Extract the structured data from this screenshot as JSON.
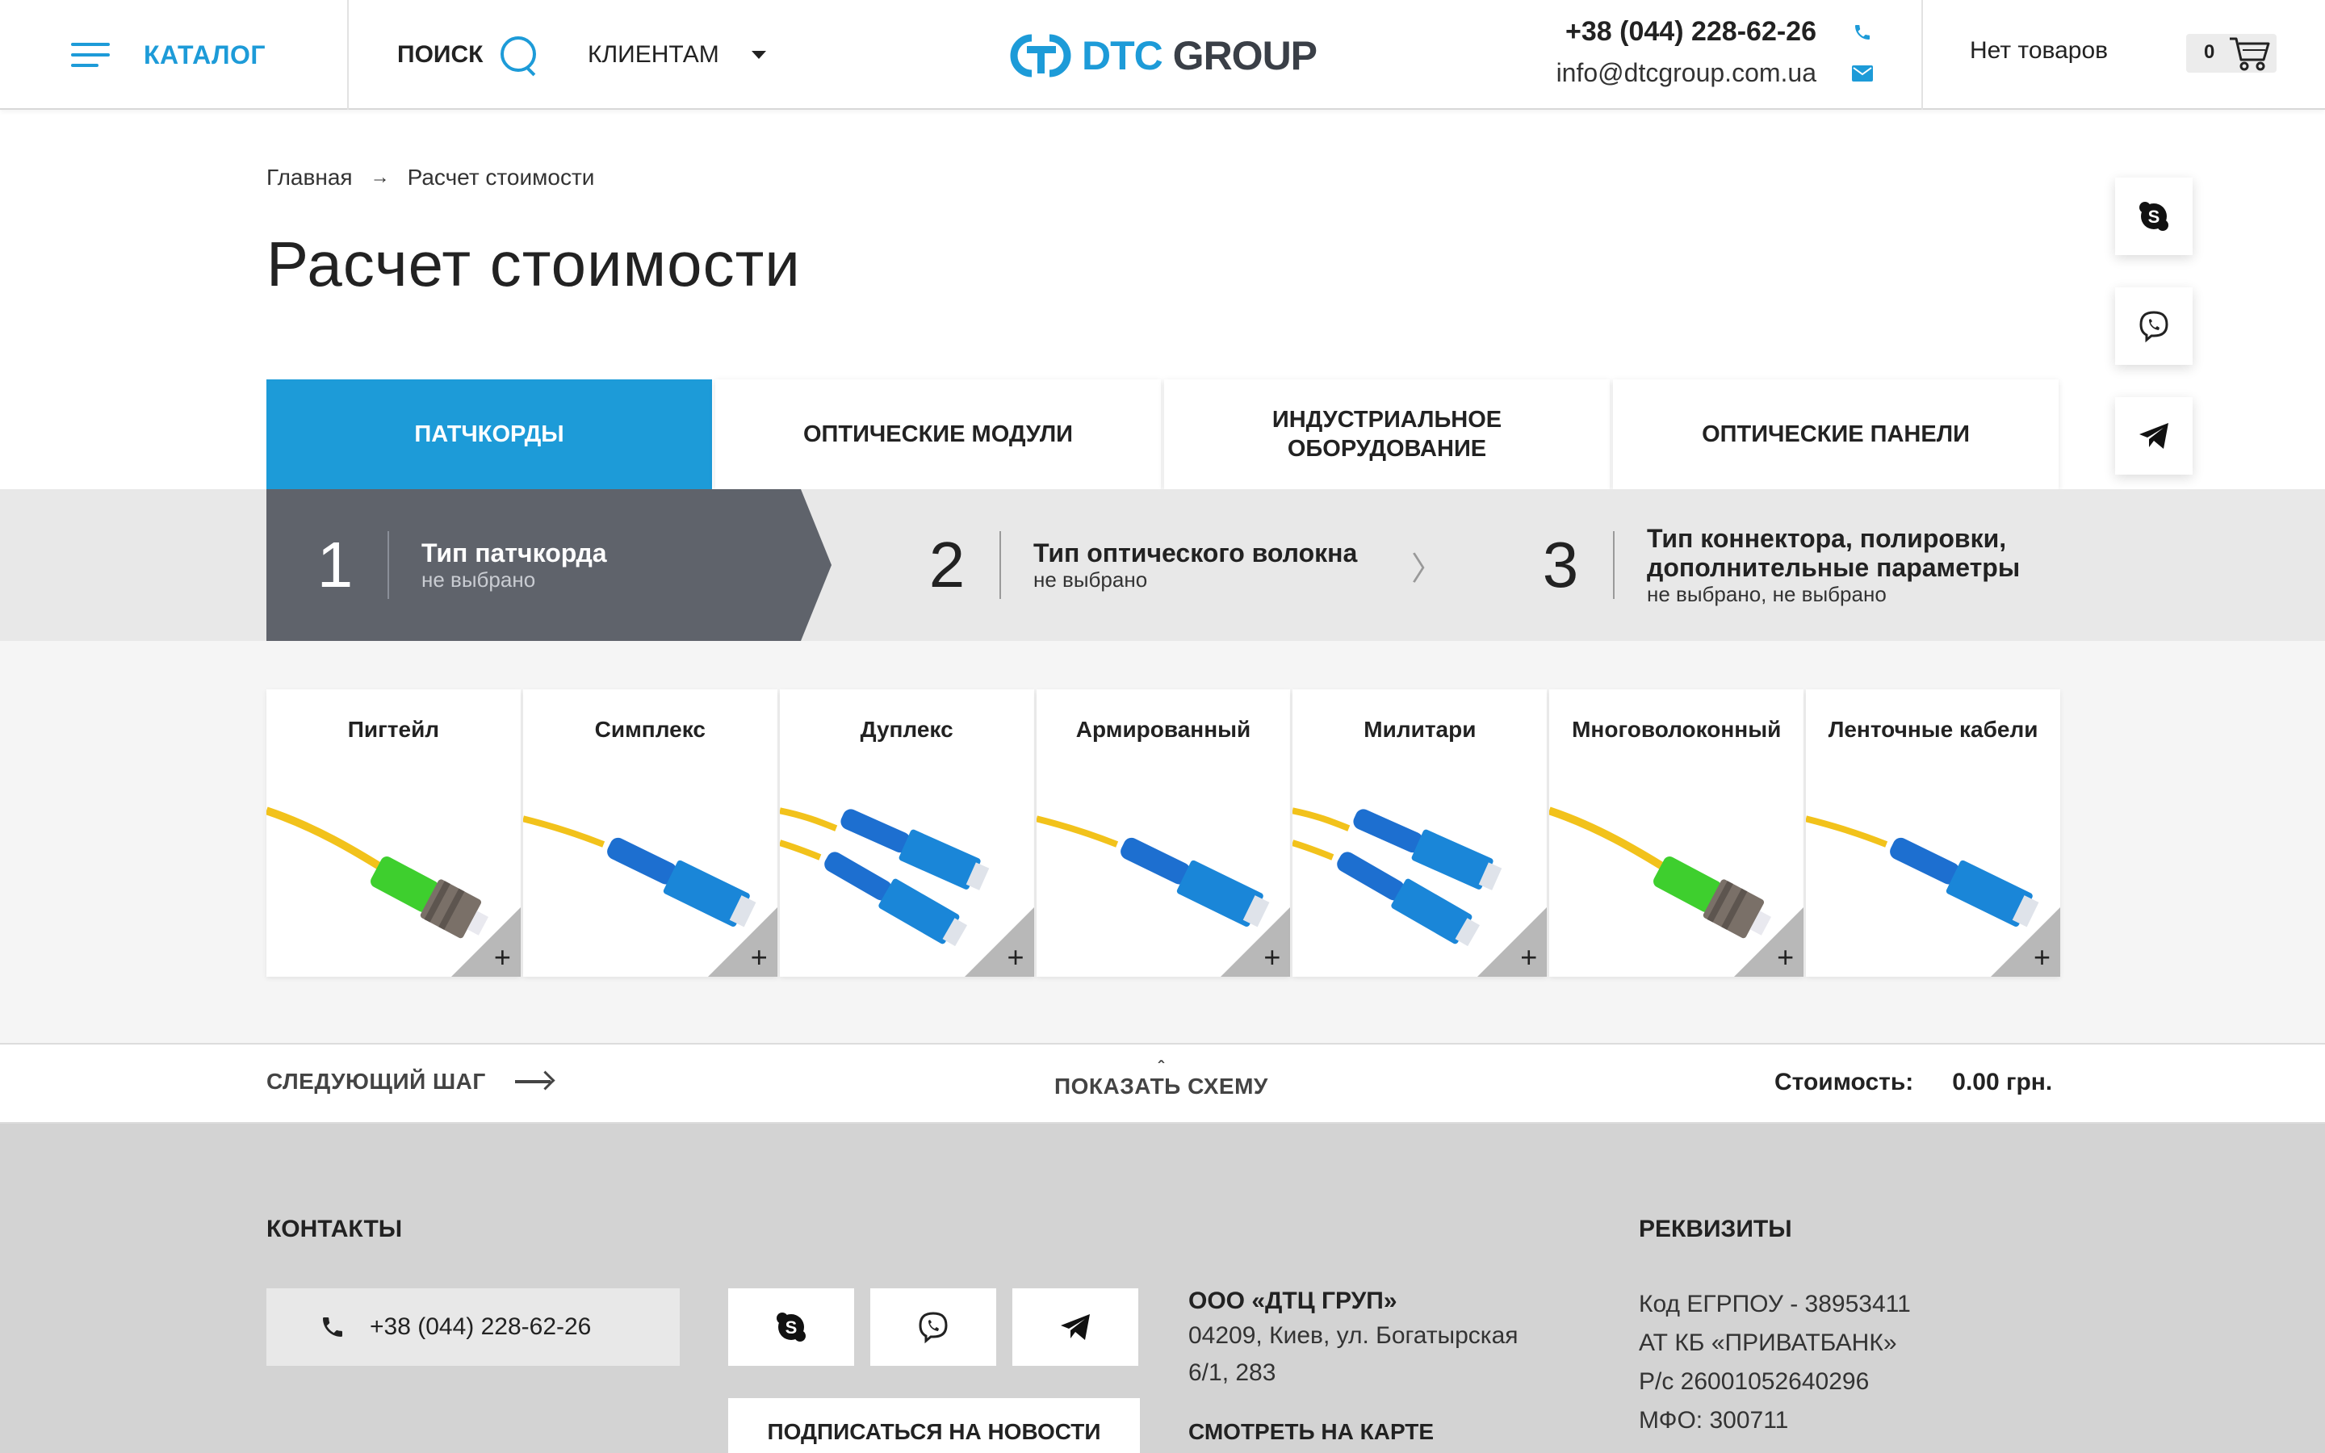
{
  "header": {
    "catalog_label": "КАТАЛОГ",
    "search_label": "ПОИСК",
    "clients_label": "КЛИЕНТАМ",
    "logo_dtc": "DTC",
    "logo_group": "GROUP",
    "phone": "+38 (044) 228-62-26",
    "email": "info@dtcgroup.com.ua",
    "cart_status": "Нет товаров",
    "cart_count": "0"
  },
  "breadcrumb": {
    "home": "Главная",
    "current": "Расчет стоимости"
  },
  "page_title": "Расчет стоимости",
  "social": [
    "skype-icon",
    "viber-icon",
    "telegram-icon"
  ],
  "tabs": [
    {
      "label": "ПАТЧКОРДЫ",
      "active": true
    },
    {
      "label": "ОПТИЧЕСКИЕ МОДУЛИ",
      "active": false
    },
    {
      "label": "ИНДУСТРИАЛЬНОЕ ОБОРУДОВАНИЕ",
      "active": false
    },
    {
      "label": "ОПТИЧЕСКИЕ ПАНЕЛИ",
      "active": false
    }
  ],
  "steps": [
    {
      "num": "1",
      "title": "Тип патчкорда",
      "sub": "не выбрано"
    },
    {
      "num": "2",
      "title": "Тип оптического волокна",
      "sub": "не выбрано"
    },
    {
      "num": "3",
      "title": "Тип коннектора, полировки, дополнительные параметры",
      "sub": "не выбрано, не выбрано"
    }
  ],
  "cards": [
    {
      "title": "Пигтейл",
      "image": "pigtail-green"
    },
    {
      "title": "Симплекс",
      "image": "simplex-blue"
    },
    {
      "title": "Дуплекс",
      "image": "duplex-blue"
    },
    {
      "title": "Армированный",
      "image": "simplex-blue"
    },
    {
      "title": "Милитари",
      "image": "duplex-blue"
    },
    {
      "title": "Многоволоконный",
      "image": "pigtail-green"
    },
    {
      "title": "Ленточные кабели",
      "image": "simplex-blue"
    }
  ],
  "card_plus": "+",
  "bottom_bar": {
    "next_step": "СЛЕДУЮЩИЙ ШАГ",
    "show_scheme": "ПОКАЗАТЬ СХЕМУ",
    "cost_label": "Стоимость:",
    "cost_value": "0.00 грн."
  },
  "footer": {
    "contacts_heading": "КОНТАКТЫ",
    "phone": "+38 (044) 228-62-26",
    "subscribe": "ПОДПИСАТЬСЯ НА НОВОСТИ",
    "company_name": "ООО «ДТЦ ГРУП»",
    "address_line1": "04209, Киев, ул. Богатырская",
    "address_line2": "6/1, 283",
    "map_link": "СМОТРЕТЬ НА КАРТЕ",
    "requisites_heading": "РЕКВИЗИТЫ",
    "requisites": [
      "Код ЕГРПОУ - 38953411",
      "АТ КБ «ПРИВАТБАНК»",
      "Р/с 26001052640296",
      "МФО: 300711"
    ]
  },
  "colors": {
    "accent": "#1d9bd8",
    "step_active": "#5f636b",
    "step_band": "#e8e8e8",
    "footer_bg": "#d3d3d3"
  }
}
